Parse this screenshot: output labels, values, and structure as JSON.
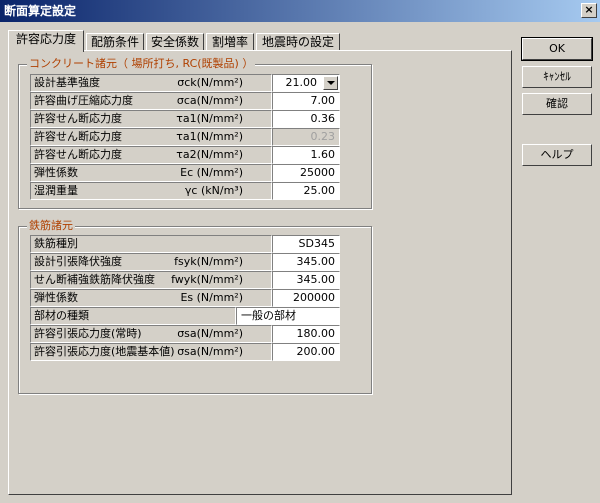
{
  "window": {
    "title": "断面算定設定",
    "close": "×"
  },
  "tabs": [
    "許容応力度",
    "配筋条件",
    "安全係数",
    "割増率",
    "地震時の設定"
  ],
  "buttons": {
    "ok": "OK",
    "cancel": "ｷｬﾝｾﾙ",
    "confirm": "確認",
    "help": "ヘルプ"
  },
  "concrete": {
    "title": "コンクリート諸元（ 場所打ち, RC(既製品) ）",
    "rows": [
      {
        "label": "設計基準強度",
        "symbol": "σck(N/mm²)",
        "value": "21.00",
        "combo": true
      },
      {
        "label": "許容曲げ圧縮応力度",
        "symbol": "σca(N/mm²)",
        "value": "7.00"
      },
      {
        "label": "許容せん断応力度",
        "symbol": "τa1(N/mm²)",
        "value": "0.36"
      },
      {
        "label": "許容せん断応力度",
        "symbol": "τa1(N/mm²)",
        "value": "0.23",
        "disabled": true
      },
      {
        "label": "許容せん断応力度",
        "symbol": "τa2(N/mm²)",
        "value": "1.60"
      },
      {
        "label": "弾性係数",
        "symbol": "Ec (N/mm²)",
        "value": "25000"
      },
      {
        "label": "湿潤重量",
        "symbol": "γc (kN/m³)",
        "value": "25.00"
      }
    ]
  },
  "steel": {
    "title": "鉄筋諸元",
    "rows": [
      {
        "label": "鉄筋種別",
        "symbol": "",
        "value": "SD345"
      },
      {
        "label": "設計引張降伏強度",
        "symbol": "fsyk(N/mm²)",
        "value": "345.00"
      },
      {
        "label": "せん断補強鉄筋降伏強度",
        "symbol": "fwyk(N/mm²)",
        "value": "345.00"
      },
      {
        "label": "弾性係数",
        "symbol": "Es (N/mm²)",
        "value": "200000"
      },
      {
        "label": "部材の種類",
        "symbol": "",
        "value": "一般の部材",
        "text": true
      },
      {
        "label": "許容引張応力度(常時)",
        "symbol": "σsa(N/mm²)",
        "value": "180.00"
      },
      {
        "label": "許容引張応力度(地震基本値)",
        "symbol": "σsa(N/mm²)",
        "value": "200.00"
      }
    ]
  }
}
